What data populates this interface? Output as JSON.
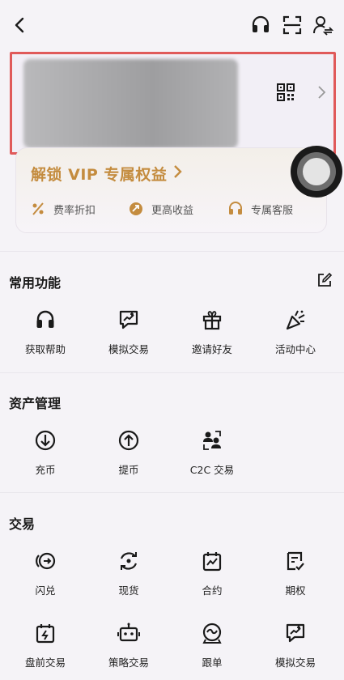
{
  "header": {
    "icons": [
      "back-icon",
      "headset-icon",
      "scan-icon",
      "switch-account-icon"
    ]
  },
  "profile": {
    "icons": [
      "qr-code-icon",
      "chevron-right-icon"
    ]
  },
  "vip": {
    "title": "解锁 VIP 专属权益",
    "perks": [
      {
        "label": "费率折扣",
        "icon": "percent-icon"
      },
      {
        "label": "更高收益",
        "icon": "yield-icon"
      },
      {
        "label": "专属客服",
        "icon": "support-icon"
      }
    ],
    "accent": "#c48c3f"
  },
  "sections": {
    "common": {
      "title": "常用功能",
      "items": [
        {
          "label": "获取帮助",
          "icon": "headset-icon"
        },
        {
          "label": "模拟交易",
          "icon": "demo-trade-icon"
        },
        {
          "label": "邀请好友",
          "icon": "gift-icon"
        },
        {
          "label": "活动中心",
          "icon": "party-icon"
        }
      ]
    },
    "assets": {
      "title": "资产管理",
      "items": [
        {
          "label": "充币",
          "icon": "deposit-icon"
        },
        {
          "label": "提币",
          "icon": "withdraw-icon"
        },
        {
          "label": "C2C 交易",
          "icon": "c2c-icon"
        }
      ]
    },
    "trade": {
      "title": "交易",
      "items": [
        {
          "label": "闪兑",
          "icon": "convert-icon"
        },
        {
          "label": "现货",
          "icon": "spot-icon"
        },
        {
          "label": "合约",
          "icon": "futures-icon"
        },
        {
          "label": "期权",
          "icon": "options-icon"
        },
        {
          "label": "盘前交易",
          "icon": "premarket-icon"
        },
        {
          "label": "策略交易",
          "icon": "bot-icon"
        },
        {
          "label": "跟单",
          "icon": "copy-trade-icon"
        },
        {
          "label": "模拟交易",
          "icon": "demo-trade-icon"
        }
      ]
    }
  },
  "colors": {
    "background": "#f5f3f7",
    "highlight_border": "#e05a5a",
    "text": "#1a1a1a"
  }
}
